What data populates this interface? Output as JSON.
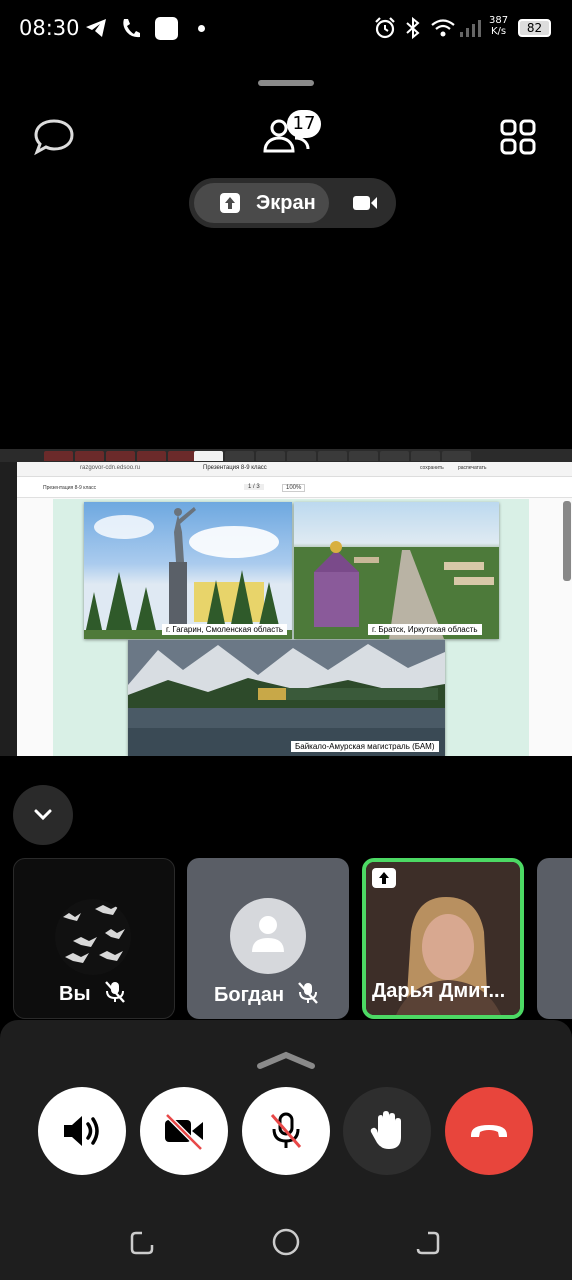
{
  "status_bar": {
    "time": "08:30",
    "net_speed_value": "387",
    "net_speed_unit": "K/s",
    "battery": "82",
    "icons": [
      "telegram-icon",
      "phone-icon",
      "app-square-icon",
      "dot-icon",
      "alarm-icon",
      "bluetooth-icon",
      "wifi-icon",
      "signal-icon"
    ]
  },
  "call_header": {
    "participants_count": "17",
    "icons": [
      "chat-icon",
      "participants-icon",
      "grid-layout-icon"
    ],
    "toggle": {
      "screen_label": "Экран"
    }
  },
  "shared_screen": {
    "url": "razgovor-cdn.edsoo.ru",
    "tab_title": "Презентация 8-9 класс",
    "save_label": "сохранить",
    "print_label": "распечатать",
    "pdf_title": "Презентация 8-9 класс",
    "page_indicator": "1 / 3",
    "zoom": "100%",
    "captions": [
      "г. Гагарин, Смоленская область",
      "г. Братск, Иркутская область",
      "Байкало-Амурская магистраль (БАМ)"
    ]
  },
  "participants": [
    {
      "name": "Вы",
      "muted": true
    },
    {
      "name": "Богдан",
      "muted": true
    },
    {
      "name": "Дарья Дмит...",
      "sharing_screen": true,
      "speaking": true
    }
  ],
  "controls": [
    "speaker-icon",
    "camera-off-icon",
    "mic-off-icon",
    "raise-hand-icon",
    "hang-up-icon"
  ],
  "colors": {
    "speaking_border": "#4cd964",
    "hangup": "#e8453c",
    "control_white": "#ffffff",
    "control_dark": "#2e2e2e"
  }
}
